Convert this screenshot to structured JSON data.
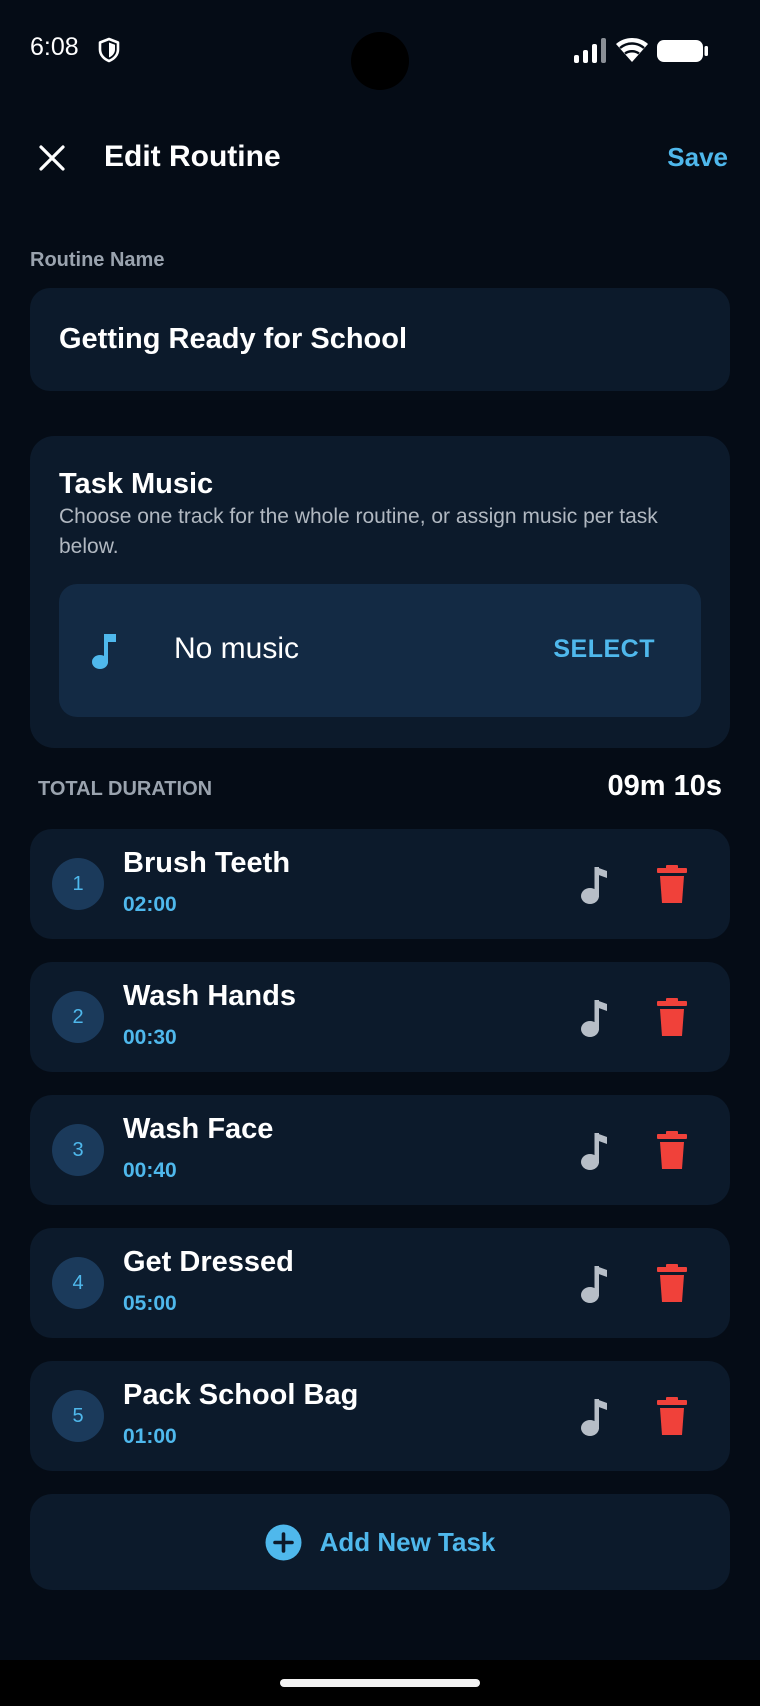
{
  "status_bar": {
    "time": "6:08",
    "icons": [
      "shield-icon",
      "signal-icon",
      "wifi-icon",
      "battery-icon"
    ]
  },
  "header": {
    "title": "Edit Routine",
    "save_label": "Save",
    "close_icon": "close-icon"
  },
  "routine_name": {
    "label": "Routine Name",
    "value": "Getting Ready for School"
  },
  "task_music": {
    "title": "Task Music",
    "description": "Choose one track for the whole routine, or assign music per task below.",
    "current": "No music",
    "select_label": "SELECT",
    "icon": "music-note-icon"
  },
  "total_duration": {
    "label": "TOTAL DURATION",
    "value": "09m 10s"
  },
  "tasks": [
    {
      "number": "1",
      "name": "Brush Teeth",
      "duration": "02:00"
    },
    {
      "number": "2",
      "name": "Wash Hands",
      "duration": "00:30"
    },
    {
      "number": "3",
      "name": "Wash Face",
      "duration": "00:40"
    },
    {
      "number": "4",
      "name": "Get Dressed",
      "duration": "05:00"
    },
    {
      "number": "5",
      "name": "Pack School Bag",
      "duration": "01:00"
    }
  ],
  "add_task": {
    "label": "Add New Task",
    "icon": "plus-circle-icon"
  },
  "colors": {
    "background": "#050c16",
    "card": "#0c1a2b",
    "card_inner": "#132a44",
    "accent": "#4fb8ec",
    "danger": "#f0413a",
    "muted_icon": "#b7bec7",
    "label": "#9aa3ae"
  }
}
